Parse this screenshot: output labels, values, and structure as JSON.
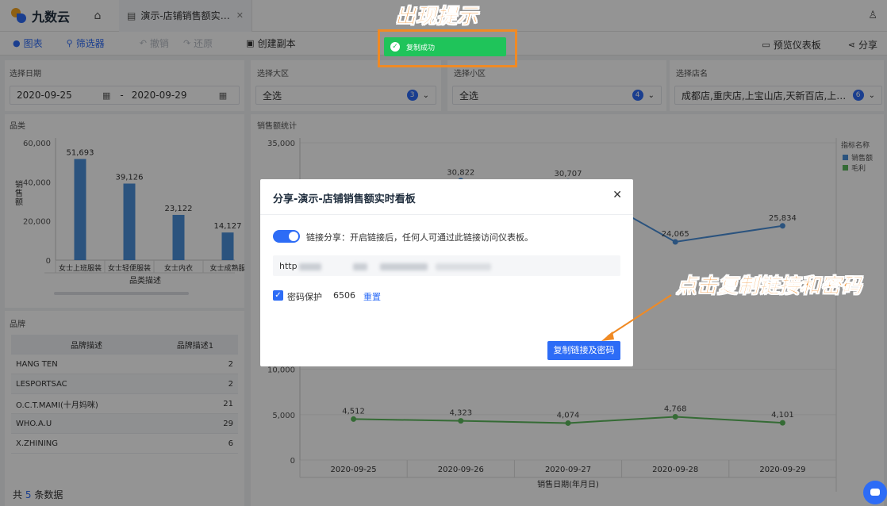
{
  "app": {
    "name": "九数云"
  },
  "tab": {
    "label": "演示-店铺销售额实时..."
  },
  "toolbar": {
    "chart": "图表",
    "filter": "筛选器",
    "undo": "撤销",
    "redo": "还原",
    "copy": "创建副本",
    "preview": "预览仪表板",
    "share": "分享"
  },
  "filters": {
    "date": {
      "label": "选择日期",
      "start": "2020-09-25",
      "sep": "-",
      "end": "2020-09-29"
    },
    "region": {
      "label": "选择大区",
      "value": "全选",
      "count": "3"
    },
    "subregion": {
      "label": "选择小区",
      "value": "全选",
      "count": "4"
    },
    "store": {
      "label": "选择店名",
      "value": "成都店,重庆店,上宝山店,天新百店,上浦建...",
      "count": "6"
    }
  },
  "category_panel": {
    "title": "品类"
  },
  "sales_panel": {
    "title": "销售额统计"
  },
  "brand_panel": {
    "title": "品牌",
    "headers": [
      "品牌描述",
      "品牌描述1"
    ],
    "rows": [
      {
        "name": "HANG TEN",
        "value": "2"
      },
      {
        "name": "LESPORTSAC",
        "value": "2"
      },
      {
        "name": "O.C.T.MAMI(十月妈咪)",
        "value": "21"
      },
      {
        "name": "WHO.A.U",
        "value": "29"
      },
      {
        "name": "X.ZHINING",
        "value": "6"
      }
    ],
    "total_prefix": "共",
    "total_count": "5",
    "total_suffix": "条数据"
  },
  "chart_data": [
    {
      "type": "bar",
      "categories": [
        "女士上班服装",
        "女士轻便服装",
        "女士内衣",
        "女士成熟服"
      ],
      "values": [
        51693,
        39126,
        23122,
        14127
      ],
      "data_labels": [
        "51,693",
        "39,126",
        "23,122",
        "14,127"
      ],
      "xlabel": "品类描述",
      "ylabel": "销售额",
      "ylim": [
        0,
        60000
      ],
      "yticks": [
        "60,000",
        "40,000",
        "20,000",
        "0"
      ],
      "bar_color": "#4a90d9"
    },
    {
      "type": "line",
      "x": [
        "2020-09-25",
        "2020-09-26",
        "2020-09-27",
        "2020-09-28",
        "2020-09-29"
      ],
      "xlabel": "销售日期(年月日)",
      "ylim": [
        0,
        35000
      ],
      "yticks": [
        "35,000",
        "10,000",
        "5,000",
        "0"
      ],
      "legend_title": "指标名称",
      "legend_position": "right",
      "series": [
        {
          "name": "销售额",
          "color": "#4a90d9",
          "values": [
            null,
            30822,
            30707,
            24065,
            25834
          ],
          "labels": [
            "",
            "30,822",
            "30,707",
            "24,065",
            "25,834"
          ]
        },
        {
          "name": "毛利",
          "color": "#5cb85c",
          "values": [
            4512,
            4323,
            4074,
            4768,
            4101
          ],
          "labels": [
            "4,512",
            "4,323",
            "4,074",
            "4,768",
            "4,101"
          ]
        }
      ]
    }
  ],
  "modal": {
    "title": "分享-演示-店铺销售额实时看板",
    "switch_label": "链接分享：开启链接后，任何人可通过此链接访问仪表板。",
    "link_prefix": "http",
    "password_label": "密码保护",
    "password": "6506",
    "reset": "重置",
    "copy_button": "复制链接及密码"
  },
  "toast": {
    "text": "复制成功"
  },
  "annotations": {
    "top": "出现提示",
    "right": "点击复制链接和密码"
  },
  "colors": {
    "accent": "#2d6cf6",
    "annotation": "#f08a24",
    "success": "#1fc45a"
  }
}
